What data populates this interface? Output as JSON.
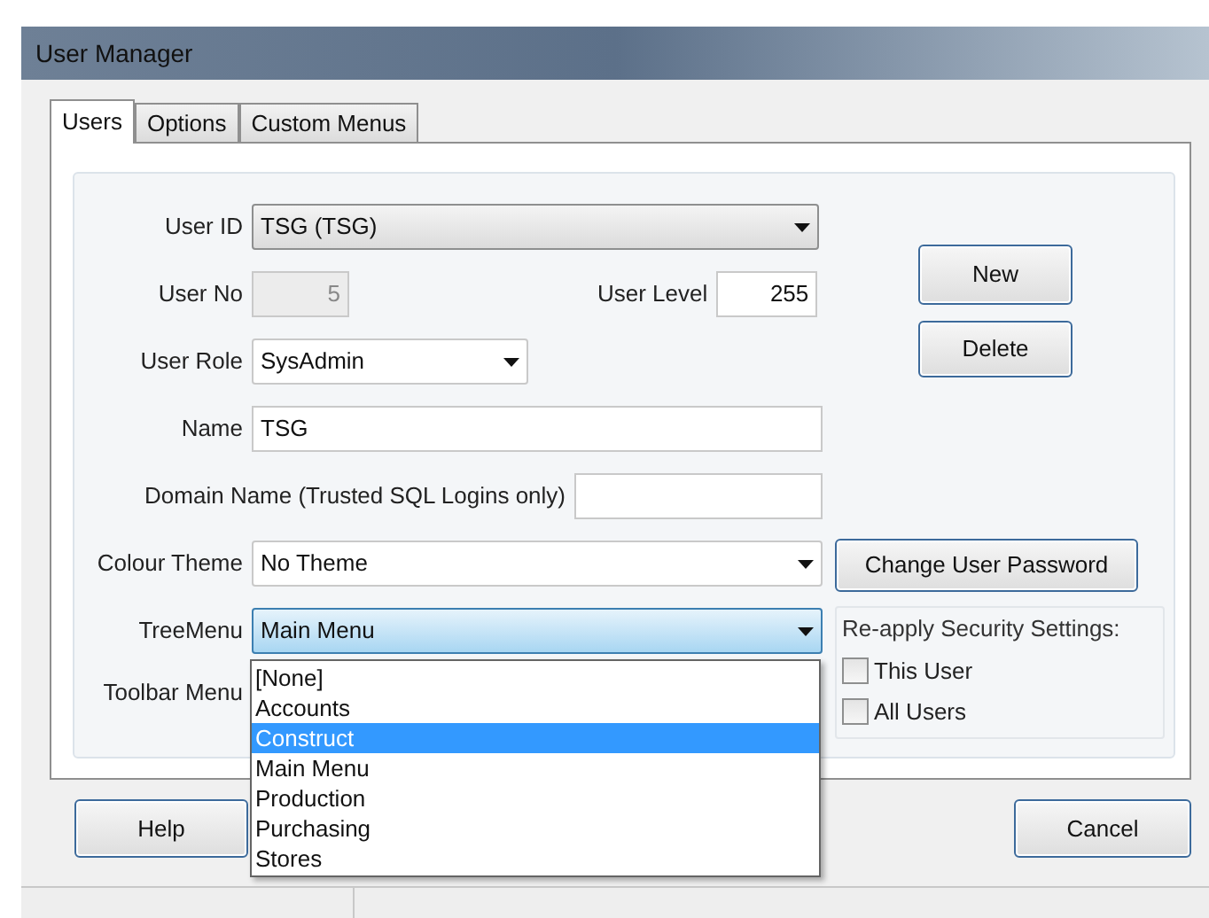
{
  "window": {
    "title": "User Manager"
  },
  "tabs": [
    {
      "label": "Users",
      "selected": true
    },
    {
      "label": "Options",
      "selected": false
    },
    {
      "label": "Custom Menus",
      "selected": false
    }
  ],
  "form": {
    "user_id": {
      "label": "User ID",
      "value": "TSG (TSG)"
    },
    "user_no": {
      "label": "User No",
      "value": "5",
      "disabled": true
    },
    "user_level": {
      "label": "User Level",
      "value": "255"
    },
    "user_role": {
      "label": "User Role",
      "value": "SysAdmin"
    },
    "name": {
      "label": "Name",
      "value": "TSG"
    },
    "domain_name": {
      "label": "Domain Name (Trusted SQL Logins only)"
    },
    "colour_theme": {
      "label": "Colour Theme",
      "value": "No Theme"
    },
    "tree_menu": {
      "label": "TreeMenu",
      "value": "Main Menu",
      "expanded": true,
      "options": [
        {
          "label": "[None]",
          "highlighted": false
        },
        {
          "label": "Accounts",
          "highlighted": false
        },
        {
          "label": "Construct",
          "highlighted": true
        },
        {
          "label": "Main Menu",
          "highlighted": false
        },
        {
          "label": "Production",
          "highlighted": false
        },
        {
          "label": "Purchasing",
          "highlighted": false
        },
        {
          "label": "Stores",
          "highlighted": false
        }
      ]
    },
    "toolbar_menu": {
      "label": "Toolbar Menu"
    }
  },
  "side_buttons": {
    "new": "New",
    "delete": "Delete",
    "change_password": "Change User Password"
  },
  "reapply": {
    "title": "Re-apply Security Settings:",
    "options": [
      {
        "label": "This User",
        "checked": false
      },
      {
        "label": "All Users",
        "checked": false
      }
    ]
  },
  "footer": {
    "help": "Help",
    "cancel": "Cancel"
  }
}
